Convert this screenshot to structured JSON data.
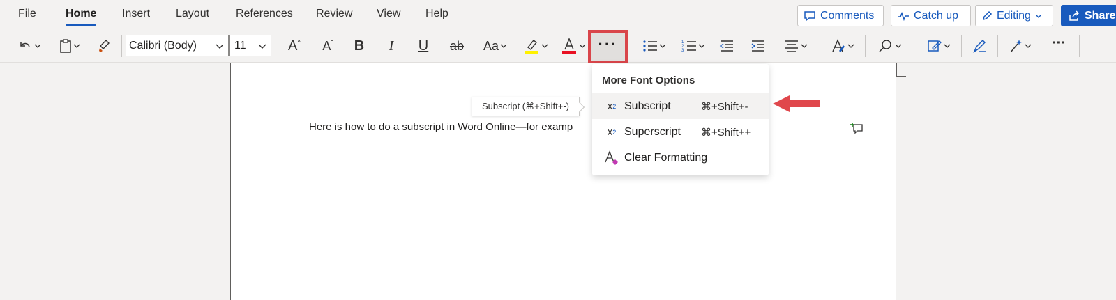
{
  "tabs": [
    {
      "label": "File",
      "active": false
    },
    {
      "label": "Home",
      "active": true
    },
    {
      "label": "Insert",
      "active": false
    },
    {
      "label": "Layout",
      "active": false
    },
    {
      "label": "References",
      "active": false
    },
    {
      "label": "Review",
      "active": false
    },
    {
      "label": "View",
      "active": false
    },
    {
      "label": "Help",
      "active": false
    }
  ],
  "header_buttons": {
    "comments": "Comments",
    "catch_up": "Catch up",
    "editing": "Editing",
    "share": "Share"
  },
  "toolbar": {
    "font_name": "Calibri (Body)",
    "font_size": "11",
    "bold_glyph": "B",
    "italic_glyph": "I",
    "underline_glyph": "U",
    "strike_glyph": "ab",
    "case_glyph": "Aa",
    "highlight_color": "#fff100",
    "font_color": "#e81123",
    "more_glyph": "···"
  },
  "document": {
    "text": "Here is how to do a subscript in Word Online—for examp"
  },
  "tooltip": {
    "text": "Subscript (⌘+Shift+-)"
  },
  "menu": {
    "title": "More Font Options",
    "items": [
      {
        "label": "Subscript",
        "shortcut": "⌘+Shift+-",
        "icon": "subscript-icon"
      },
      {
        "label": "Superscript",
        "shortcut": "⌘+Shift++",
        "icon": "superscript-icon"
      },
      {
        "label": "Clear Formatting",
        "shortcut": "",
        "icon": "clear-formatting-icon"
      }
    ]
  },
  "colors": {
    "accent": "#185abd",
    "highlight_box": "#d9454a",
    "arrow": "#e0474c"
  }
}
